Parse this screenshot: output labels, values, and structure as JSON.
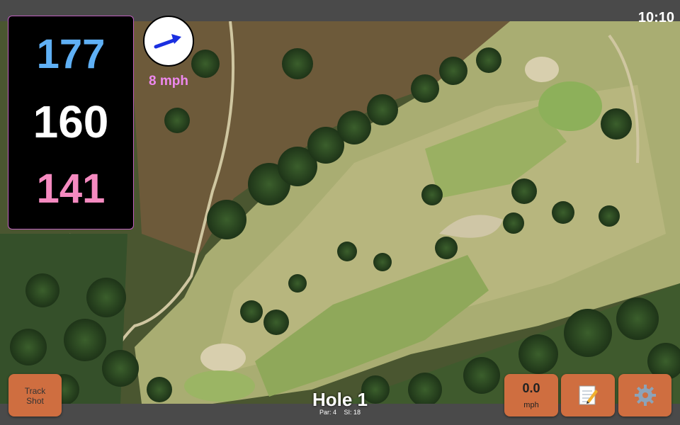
{
  "clock": "10:10",
  "yardages": {
    "back": "177",
    "middle": "160",
    "front": "141"
  },
  "colors": {
    "back": "#5fb0f5",
    "middle": "#ffffff",
    "front": "#f58ac0",
    "button": "#cf6e40",
    "wind_arrow": "#1a2fe0",
    "wind_text": "#ee88ee"
  },
  "wind": {
    "speed": "8 mph",
    "arrow_icon": "wind-direction-arrow"
  },
  "track_button": {
    "line1": "Track",
    "line2": "Shot"
  },
  "speed_button": {
    "value": "0.0",
    "unit": "mph"
  },
  "notes_button": {
    "icon": "notepad-icon"
  },
  "settings_button": {
    "icon": "gear-icon"
  },
  "hole": {
    "title": "Hole 1",
    "par": "Par: 4",
    "si": "SI: 18"
  },
  "map": {
    "icon": "satellite-course-map"
  }
}
